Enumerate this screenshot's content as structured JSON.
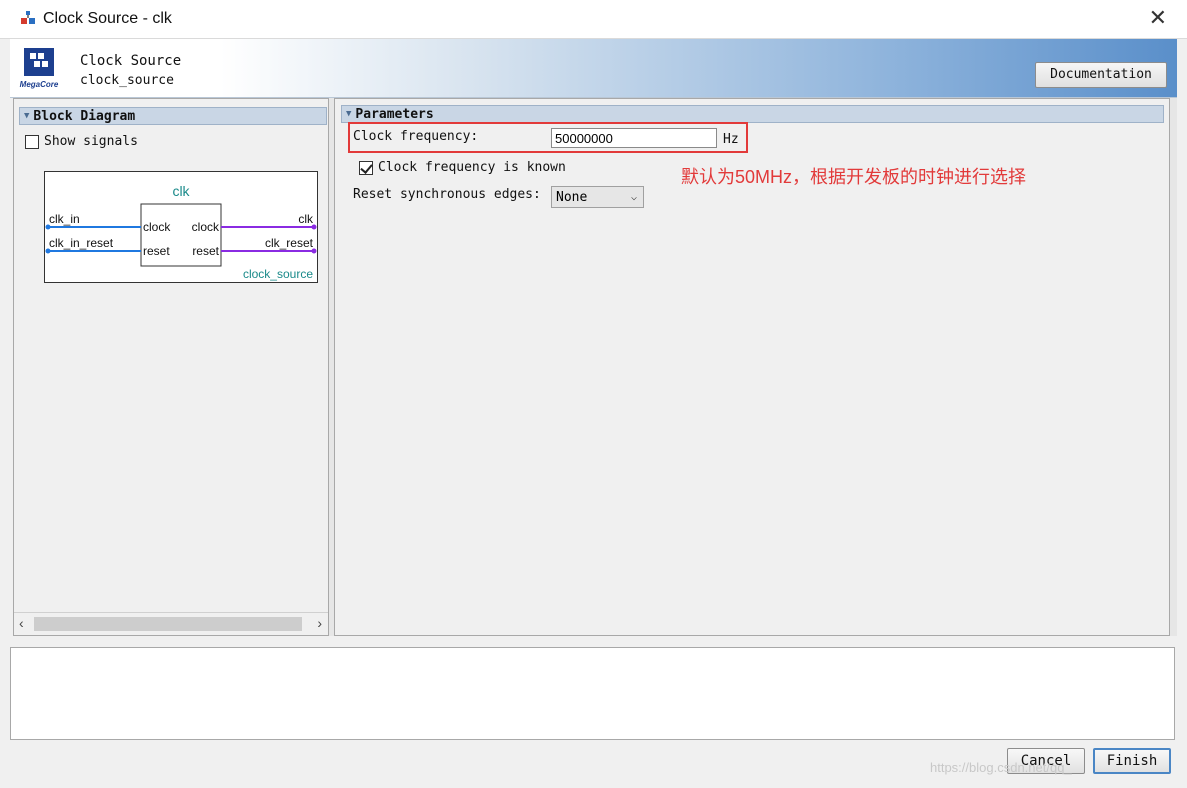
{
  "window": {
    "title": "Clock Source - clk"
  },
  "header": {
    "title": "Clock Source",
    "subtitle": "clock_source",
    "logo_text": "MegaCore",
    "documentation_label": "Documentation"
  },
  "block_diagram": {
    "section_title": "Block Diagram",
    "show_signals_label": "Show signals",
    "show_signals_checked": false,
    "component_name": "clk",
    "instance_name": "clock_source",
    "ports": {
      "left_ext_1": "clk_in",
      "left_ext_2": "clk_in_reset",
      "inner_left_1": "clock",
      "inner_left_2": "reset",
      "inner_right_1": "clock",
      "inner_right_2": "reset",
      "right_ext_1": "clk",
      "right_ext_2": "clk_reset"
    },
    "colors": {
      "input_line": "#1f78e0",
      "output_line": "#8a2be2",
      "name_text": "#1a8a8a"
    }
  },
  "parameters": {
    "section_title": "Parameters",
    "clock_frequency_label": "Clock frequency:",
    "clock_frequency_value": "50000000",
    "clock_frequency_unit": "Hz",
    "frequency_known_label": "Clock frequency is known",
    "frequency_known_checked": true,
    "reset_edges_label": "Reset synchronous edges:",
    "reset_edges_value": "None",
    "annotation": "默认为50MHz，根据开发板的时钟进行选择",
    "highlight_color": "#e23a3a"
  },
  "footer": {
    "cancel_label": "Cancel",
    "finish_label": "Finish",
    "watermark": "https://blog.csdn.net/qq_"
  }
}
